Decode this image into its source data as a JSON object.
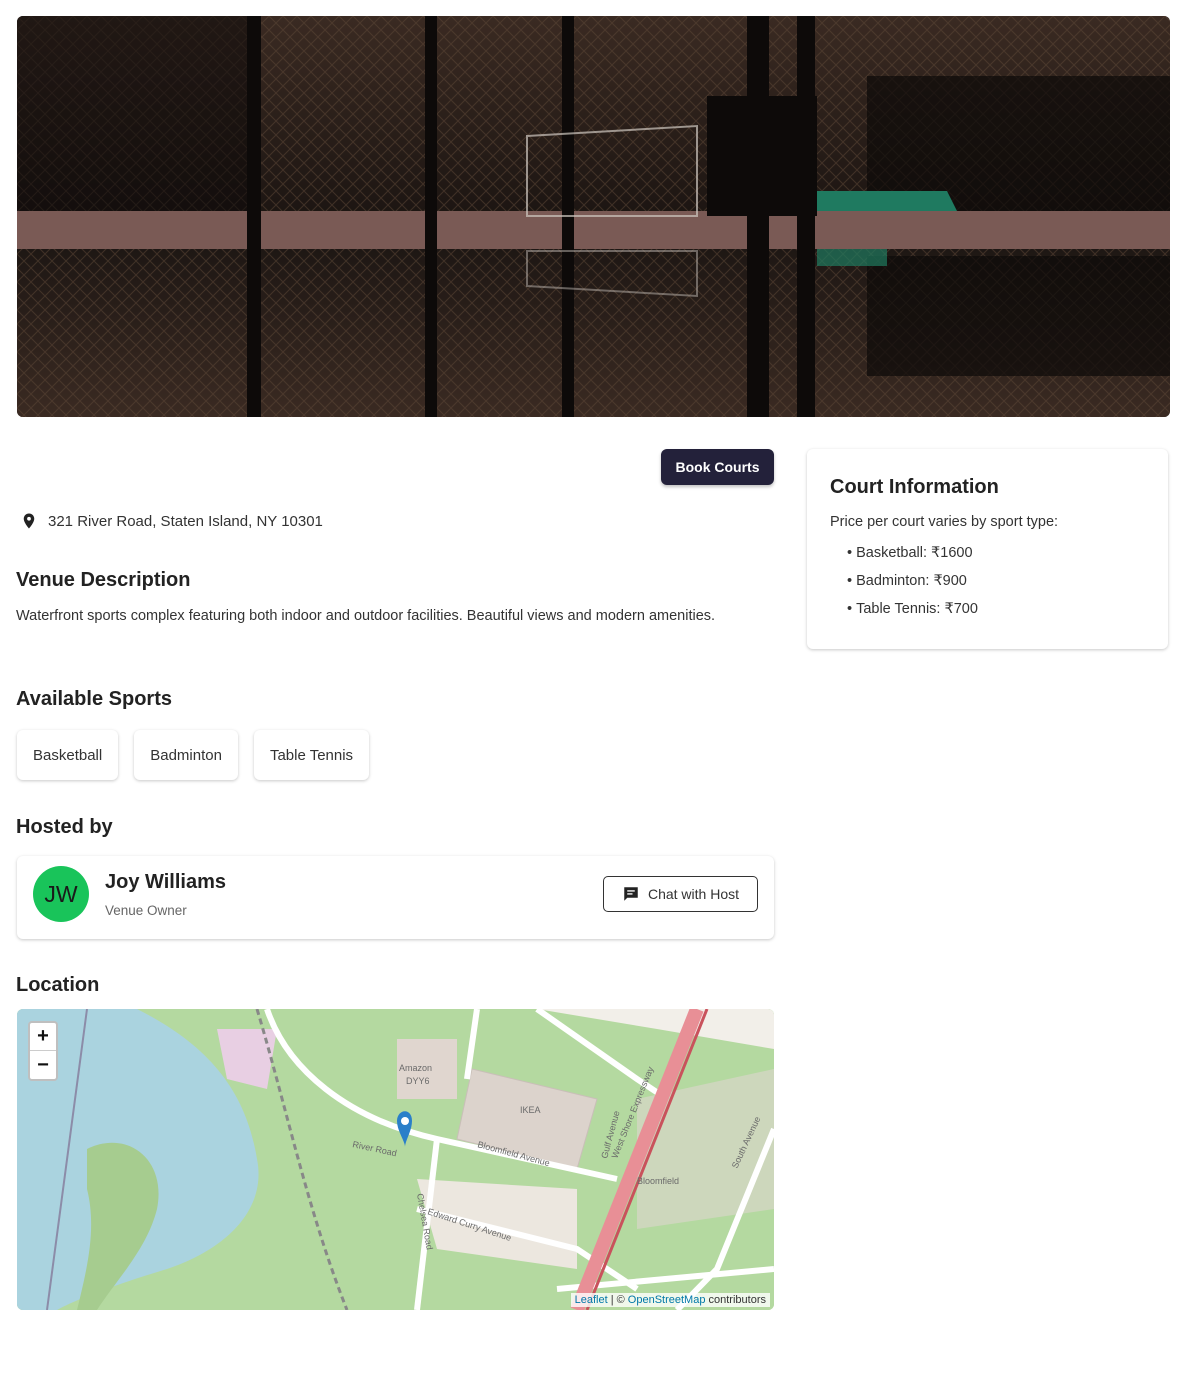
{
  "hero": {
    "alt": "Venue photo"
  },
  "actions": {
    "book_label": "Book Courts"
  },
  "venue": {
    "address": "321 River Road, Staten Island, NY 10301"
  },
  "description": {
    "heading": "Venue Description",
    "text": "Waterfront sports complex featuring both indoor and outdoor facilities. Beautiful views and modern amenities."
  },
  "sports": {
    "heading": "Available Sports",
    "items": [
      "Basketball",
      "Badminton",
      "Table Tennis"
    ]
  },
  "host": {
    "heading": "Hosted by",
    "initials": "JW",
    "name": "Joy Williams",
    "role": "Venue Owner",
    "chat_label": "Chat with Host",
    "avatar_color": "#19c45a"
  },
  "location": {
    "heading": "Location",
    "zoom_in": "+",
    "zoom_out": "−",
    "map_labels": {
      "amazon": "Amazon",
      "dyy6": "DYY6",
      "ikea": "IKEA",
      "bloomfield_ave": "Bloomfield Avenue",
      "bloomfield": "Bloomfield",
      "edward_curry": "Edward Curry Avenue",
      "west_shore": "West Shore Expressway",
      "gulf_ave": "Gulf Avenue",
      "south_ave": "South Avenue",
      "chelsea_road": "Chelsea Road",
      "river_road": "River Road"
    },
    "attribution": {
      "leaflet": "Leaflet",
      "separator": "| ©",
      "osm": "OpenStreetMap",
      "contributors": "contributors"
    }
  },
  "court_info": {
    "title": "Court Information",
    "subtitle": "Price per court varies by sport type:",
    "prices": [
      "Basketball: ₹1600",
      "Badminton: ₹900",
      "Table Tennis: ₹700"
    ]
  },
  "colors": {
    "primary_button": "#23213a",
    "avatar": "#19c45a",
    "map_water": "#aad3df",
    "map_land": "#a8cf98"
  }
}
